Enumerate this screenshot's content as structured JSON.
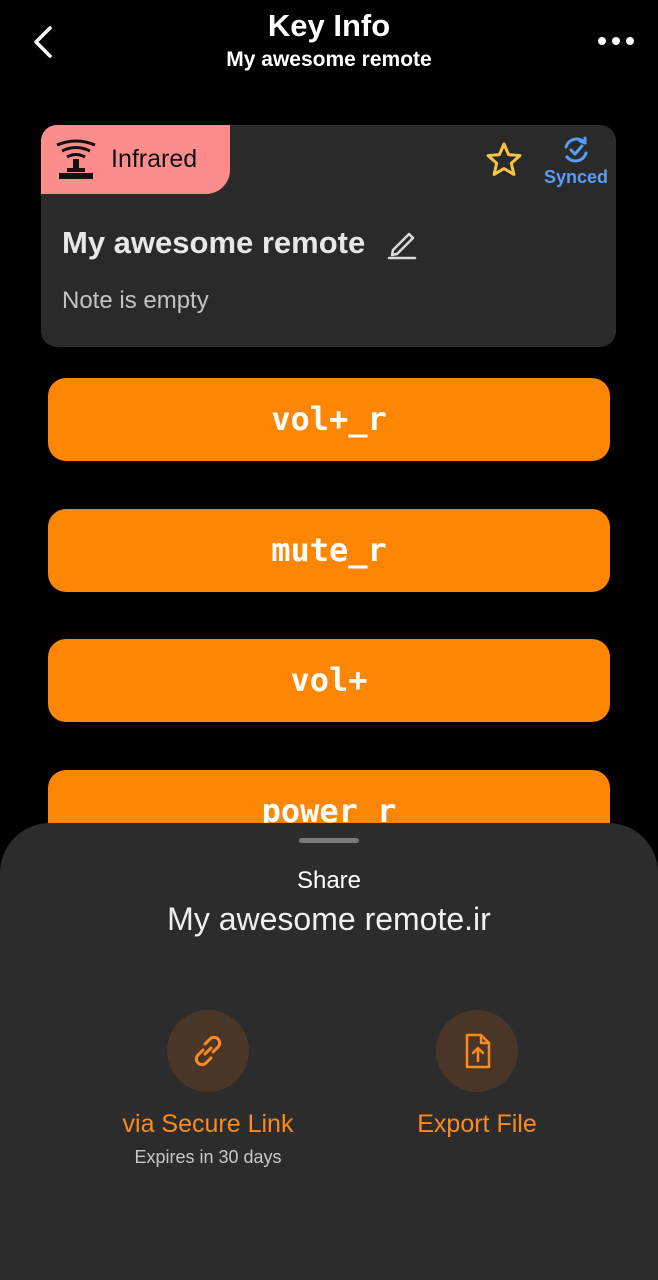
{
  "header": {
    "title": "Key Info",
    "subtitle": "My awesome remote"
  },
  "card": {
    "type_label": "Infrared",
    "type_color": "#fc8d8c",
    "synced_label": "Synced",
    "synced_color": "#589df6",
    "name": "My awesome remote",
    "note": "Note is empty"
  },
  "keys": [
    {
      "label": "vol+_r"
    },
    {
      "label": "mute_r"
    },
    {
      "label": "vol+"
    },
    {
      "label": "power_r"
    }
  ],
  "accent_color": "#fe8602",
  "share_sheet": {
    "title": "Share",
    "file_name": "My awesome remote.ir",
    "options": [
      {
        "label": "via Secure Link",
        "sublabel": "Expires in 30 days",
        "icon": "link-icon"
      },
      {
        "label": "Export File",
        "icon": "export-file-icon"
      }
    ]
  }
}
